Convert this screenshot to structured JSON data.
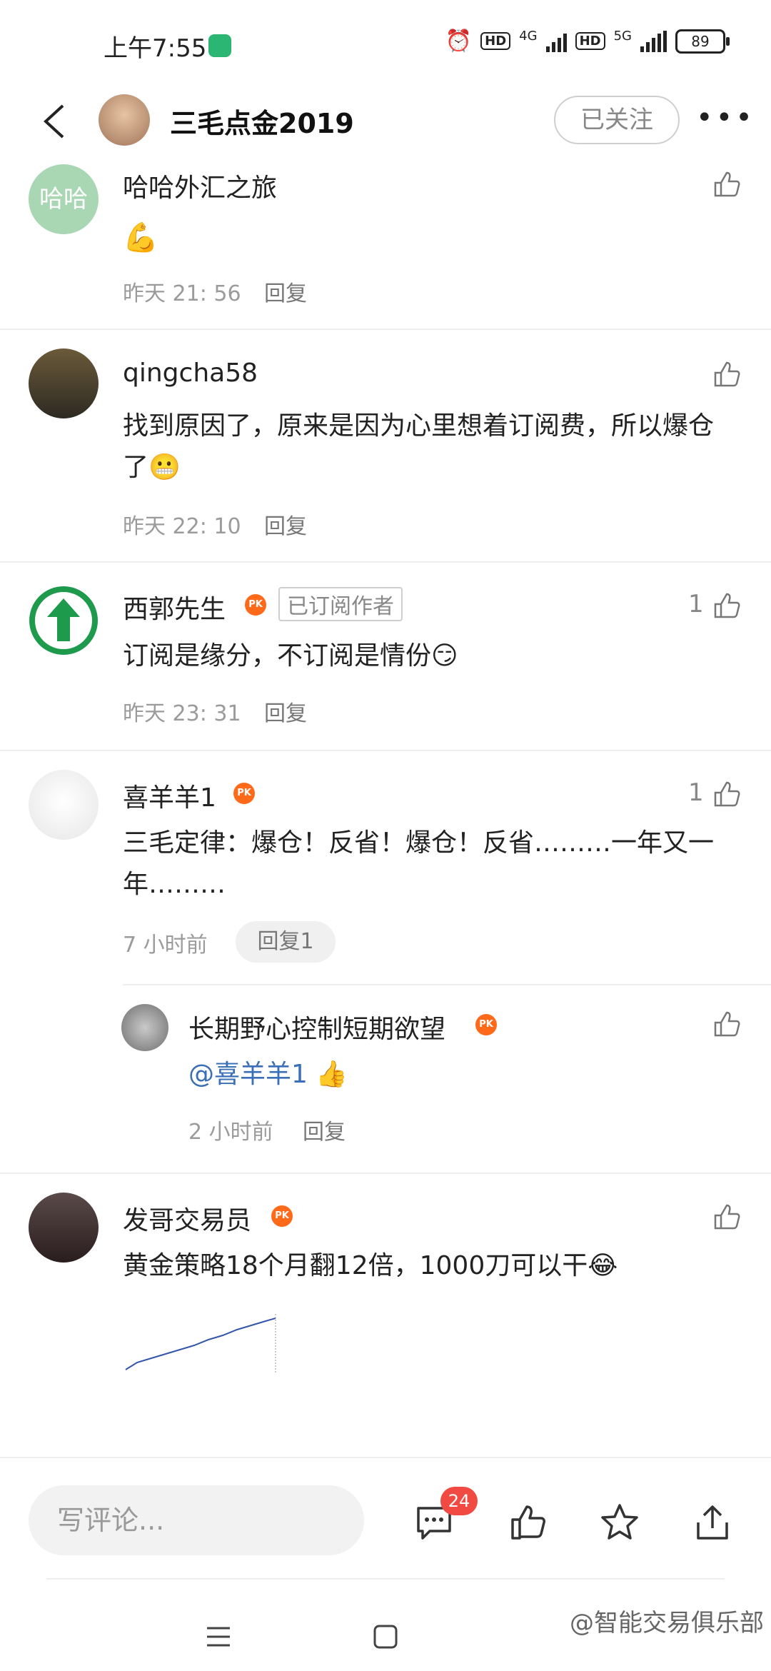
{
  "status": {
    "time": "上午7:55",
    "net1": "4G",
    "net2": "5G",
    "battery": "89"
  },
  "header": {
    "title": "三毛点金2019",
    "follow_label": "已关注",
    "more": "•••"
  },
  "comments": [
    {
      "name": "哈哈外汇之旅",
      "avatar_text": "哈哈",
      "text": "💪",
      "time": "昨天 21: 56",
      "reply": "回复"
    },
    {
      "name": "qingcha58",
      "text": "找到原因了，原来是因为心里想着订阅费，所以爆仓了😬",
      "time": "昨天 22: 10",
      "reply": "回复"
    },
    {
      "name": "西郭先生",
      "badge": "已订阅作者",
      "likes": "1",
      "text": "订阅是缘分，不订阅是情份😏",
      "time": "昨天 23: 31",
      "reply": "回复"
    },
    {
      "name": "喜羊羊1",
      "likes": "1",
      "text": "三毛定律：爆仓！反省！爆仓！反省………一年又一年………",
      "time": "7 小时前",
      "reply": "回复1"
    },
    {
      "name": "长期野心控制短期欲望",
      "mention": "@喜羊羊1",
      "text": "👍",
      "time": "2 小时前",
      "reply": "回复"
    },
    {
      "name": "发哥交易员",
      "text": "黄金策略18个月翻12倍，1000刀可以干😂",
      "time": "",
      "reply": ""
    }
  ],
  "bottom": {
    "input_placeholder": "写评论...",
    "comment_count": "24"
  },
  "watermark": "@智能交易俱乐部",
  "colors": {
    "accent": "#3b6fb6",
    "badge": "#f04a42",
    "fire": "#ff6a1a"
  },
  "icons": [
    "back-arrow-icon",
    "thumbs-up-icon",
    "comment-icon",
    "star-icon",
    "share-icon"
  ]
}
